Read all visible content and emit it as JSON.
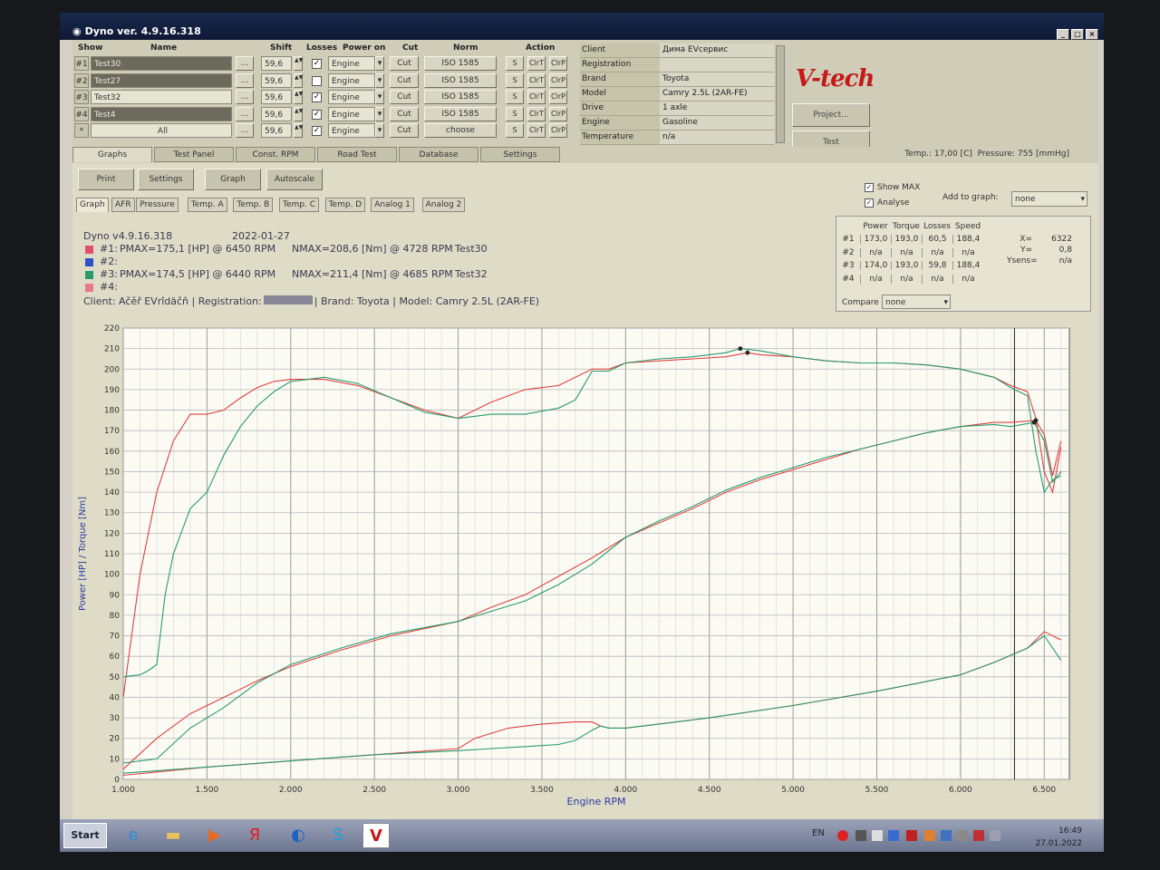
{
  "window": {
    "title": "Dyno ver. 4.9.16.318",
    "controls": [
      "_",
      "□",
      "×"
    ]
  },
  "runs_table": {
    "headers": {
      "show": "Show",
      "name": "Name",
      "shift": "Shift",
      "losses": "Losses",
      "power_on": "Power on",
      "cut": "Cut",
      "norm": "Norm",
      "action": "Action"
    },
    "rows": [
      {
        "num": "#1",
        "name": "Test30",
        "shift": "59,6",
        "losses_checked": true,
        "power_on": "Engine",
        "cut": "Cut",
        "norm": "ISO 1585"
      },
      {
        "num": "#2",
        "name": "Test27",
        "shift": "59,6",
        "losses_checked": false,
        "power_on": "Engine",
        "cut": "Cut",
        "norm": "ISO 1585"
      },
      {
        "num": "#3",
        "name": "Test32",
        "shift": "59,6",
        "losses_checked": true,
        "power_on": "Engine",
        "cut": "Cut",
        "norm": "ISO 1585"
      },
      {
        "num": "#4",
        "name": "Test4",
        "shift": "59,6",
        "losses_checked": true,
        "power_on": "Engine",
        "cut": "Cut",
        "norm": "ISO 1585"
      }
    ],
    "all_row": {
      "num": "*",
      "name": "All",
      "shift": "59,6",
      "losses_checked": true,
      "power_on": "Engine",
      "cut": "Cut",
      "norm": "choose"
    },
    "dots_label": "...",
    "action_buttons": [
      "S",
      "ClrT",
      "ClrP"
    ]
  },
  "client_info": [
    {
      "key": "Client",
      "value": "Дима EVсервис"
    },
    {
      "key": "Registration",
      "value": ""
    },
    {
      "key": "Brand",
      "value": "Toyota"
    },
    {
      "key": "Model",
      "value": "Camry 2.5L (2AR-FE)"
    },
    {
      "key": "Drive",
      "value": "1 axle"
    },
    {
      "key": "Engine",
      "value": "Gasoline"
    },
    {
      "key": "Temperature",
      "value": "n/a"
    }
  ],
  "logo": "V-tech",
  "buttons": {
    "project": "Project...",
    "test": "Test"
  },
  "tabs": [
    "Graphs",
    "Test Panel",
    "Const. RPM",
    "Road Test",
    "Database",
    "Settings"
  ],
  "status": {
    "temp": "Temp.: 17,00 [C]",
    "pressure": "Pressure: 755 [mmHg]"
  },
  "graph_buttons": [
    "Print",
    "Settings",
    "Graph",
    "Autoscale"
  ],
  "subtabs": [
    "Graph",
    "AFR",
    "Pressure",
    "Temp. A",
    "Temp. B",
    "Temp. C",
    "Temp. D",
    "Analog 1",
    "Analog 2"
  ],
  "options": {
    "show_max": "Show MAX",
    "analyse": "Analyse",
    "add_to_graph_label": "Add to graph:",
    "add_to_graph_value": "none",
    "compare_label": "Compare",
    "compare_value": "none"
  },
  "legend": {
    "version": "Dyno v4.9.16.318",
    "date": "2022-01-27",
    "lines": [
      {
        "num": "#1:",
        "pmax": "PMAX=175,1 [HP] @ 6450 RPM",
        "nmax": "NMAX=208,6 [Nm] @ 4728 RPM",
        "name": "Test30",
        "color": "#e0506a"
      },
      {
        "num": "#2:",
        "pmax": "",
        "nmax": "",
        "name": "",
        "color": "#3050c8"
      },
      {
        "num": "#3:",
        "pmax": "PMAX=174,5 [HP] @ 6440 RPM",
        "nmax": "NMAX=211,4 [Nm] @ 4685 RPM",
        "name": "Test32",
        "color": "#2a9a6a"
      },
      {
        "num": "#4:",
        "pmax": "",
        "nmax": "",
        "name": "",
        "color": "#e87890"
      }
    ],
    "client_line_a": "Client: Ačěř EVrîdăčň | Registration:",
    "client_line_b": "| Brand: Toyota | Model: Camry 2.5L (2AR-FE)"
  },
  "stats": {
    "headers": [
      "Power",
      "Torque",
      "Losses",
      "Speed"
    ],
    "rows": [
      {
        "num": "#1",
        "values": [
          "173,0",
          "193,0",
          "60,5",
          "188,4"
        ]
      },
      {
        "num": "#2",
        "values": [
          "n/a",
          "n/a",
          "n/a",
          "n/a"
        ]
      },
      {
        "num": "#3",
        "values": [
          "174,0",
          "193,0",
          "59,8",
          "188,4"
        ]
      },
      {
        "num": "#4",
        "values": [
          "n/a",
          "n/a",
          "n/a",
          "n/a"
        ]
      }
    ],
    "readout": [
      {
        "k": "X=",
        "v": "6322"
      },
      {
        "k": "Y=",
        "v": "0,8"
      },
      {
        "k": "Ysens=",
        "v": "n/a"
      }
    ]
  },
  "chart_data": {
    "type": "line",
    "xlabel": "Engine RPM",
    "ylabel": "Power [HP] / Torque [Nm]",
    "xlim": [
      1000,
      6650
    ],
    "ylim": [
      0,
      220
    ],
    "x_ticks": [
      1000,
      1500,
      2000,
      2500,
      3000,
      3500,
      4000,
      4500,
      5000,
      5500,
      6000,
      6500
    ],
    "x_tick_labels": [
      "1.000",
      "1.500",
      "2.000",
      "2.500",
      "3.000",
      "3.500",
      "4.000",
      "4.500",
      "5.000",
      "5.500",
      "6.000",
      "6.500"
    ],
    "y_ticks": [
      0,
      10,
      20,
      30,
      40,
      50,
      60,
      70,
      80,
      90,
      100,
      110,
      120,
      130,
      140,
      150,
      160,
      170,
      180,
      190,
      200,
      210,
      220
    ],
    "grid": true,
    "cursor_x": 6322,
    "series": [
      {
        "name": "Test30",
        "kind": "torque",
        "color": "#e04040",
        "x": [
          1000,
          1100,
          1200,
          1300,
          1400,
          1500,
          1600,
          1700,
          1800,
          1900,
          2000,
          2200,
          2400,
          2600,
          2800,
          3000,
          3200,
          3400,
          3600,
          3700,
          3800,
          3900,
          4000,
          4200,
          4400,
          4600,
          4728,
          4800,
          5000,
          5200,
          5400,
          5600,
          5800,
          6000,
          6200,
          6300,
          6400,
          6450,
          6500,
          6550,
          6600
        ],
        "values": [
          40,
          100,
          140,
          165,
          178,
          178,
          180,
          186,
          191,
          194,
          195,
          195,
          192,
          186,
          180,
          176,
          184,
          190,
          192,
          196,
          200,
          200,
          203,
          204,
          205,
          206,
          208,
          207,
          206,
          204,
          203,
          203,
          202,
          200,
          196,
          192,
          189,
          176,
          150,
          140,
          162
        ]
      },
      {
        "name": "Test32",
        "kind": "torque",
        "color": "#2a9a6a",
        "x": [
          1000,
          1100,
          1150,
          1200,
          1250,
          1300,
          1400,
          1500,
          1600,
          1700,
          1800,
          1900,
          2000,
          2200,
          2400,
          2600,
          2800,
          3000,
          3200,
          3400,
          3600,
          3700,
          3800,
          3900,
          4000,
          4200,
          4400,
          4600,
          4685,
          4800,
          5000,
          5200,
          5400,
          5600,
          5800,
          6000,
          6200,
          6300,
          6400,
          6450,
          6500,
          6550,
          6600
        ],
        "values": [
          50,
          51,
          53,
          56,
          90,
          110,
          132,
          140,
          158,
          172,
          182,
          189,
          194,
          196,
          193,
          186,
          179,
          176,
          178,
          178,
          181,
          185,
          199,
          199,
          203,
          205,
          206,
          208,
          210,
          209,
          206,
          204,
          203,
          203,
          202,
          200,
          196,
          191,
          187,
          160,
          140,
          146,
          148
        ]
      },
      {
        "name": "Test30",
        "kind": "power",
        "color": "#e04040",
        "x": [
          1000,
          1200,
          1400,
          1600,
          1800,
          2000,
          2300,
          2600,
          3000,
          3200,
          3400,
          3600,
          3800,
          4000,
          4200,
          4400,
          4600,
          4800,
          5000,
          5200,
          5400,
          5600,
          5800,
          6000,
          6200,
          6300,
          6450,
          6500,
          6550,
          6600
        ],
        "values": [
          5,
          20,
          32,
          40,
          48,
          55,
          63,
          70,
          77,
          84,
          90,
          99,
          108,
          118,
          125,
          132,
          140,
          146,
          151,
          156,
          161,
          165,
          169,
          172,
          174,
          174,
          175,
          168,
          148,
          165
        ]
      },
      {
        "name": "Test32",
        "kind": "power",
        "color": "#2a9a6a",
        "x": [
          1000,
          1200,
          1400,
          1600,
          1800,
          2000,
          2300,
          2600,
          3000,
          3200,
          3400,
          3600,
          3800,
          4000,
          4200,
          4400,
          4600,
          4800,
          5000,
          5200,
          5400,
          5600,
          5800,
          6000,
          6200,
          6300,
          6440,
          6500,
          6550,
          6600
        ],
        "values": [
          8,
          10,
          25,
          35,
          47,
          56,
          64,
          71,
          77,
          82,
          87,
          95,
          105,
          118,
          126,
          133,
          141,
          147,
          152,
          157,
          161,
          165,
          169,
          172,
          173,
          172,
          174,
          165,
          145,
          150
        ]
      },
      {
        "name": "Test30",
        "kind": "losses",
        "color": "#e04040",
        "x": [
          1000,
          1500,
          2000,
          2500,
          3000,
          3100,
          3300,
          3500,
          3700,
          3800,
          3850,
          3900,
          4000,
          4500,
          5000,
          5500,
          6000,
          6200,
          6400,
          6500,
          6600
        ],
        "values": [
          2,
          6,
          9,
          12,
          15,
          20,
          25,
          27,
          28,
          28,
          26,
          25,
          25,
          30,
          36,
          43,
          51,
          57,
          64,
          72,
          68
        ]
      },
      {
        "name": "Test32",
        "kind": "losses",
        "color": "#2a9a6a",
        "x": [
          1000,
          1500,
          2000,
          2500,
          3000,
          3200,
          3400,
          3600,
          3700,
          3800,
          3850,
          3900,
          4000,
          4500,
          5000,
          5500,
          6000,
          6200,
          6400,
          6500,
          6600
        ],
        "values": [
          3,
          6,
          9,
          12,
          14,
          15,
          16,
          17,
          19,
          24,
          26,
          25,
          25,
          30,
          36,
          43,
          51,
          57,
          64,
          70,
          58
        ]
      }
    ]
  },
  "taskbar": {
    "start": "Start",
    "lang": "EN",
    "time": "16:49",
    "date": "27.01.2022"
  }
}
